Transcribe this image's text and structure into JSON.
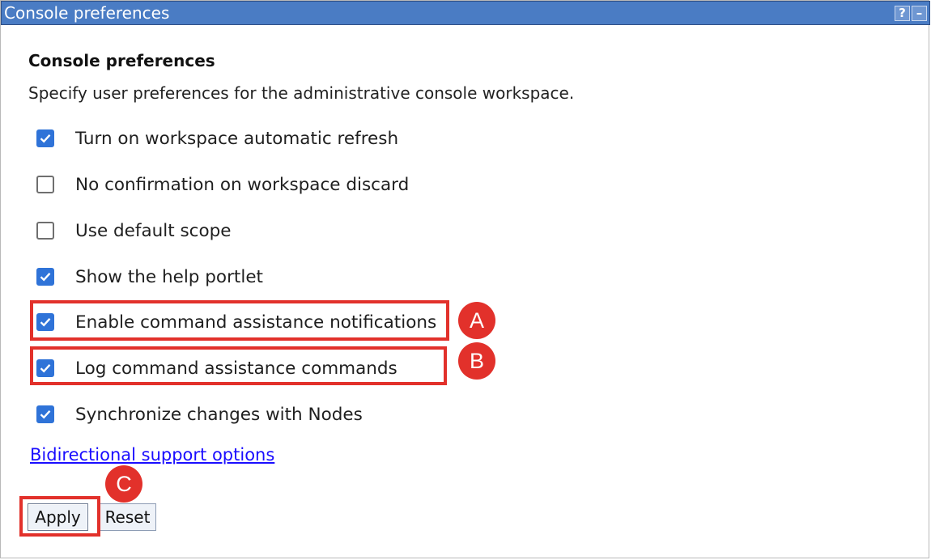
{
  "window": {
    "title": "Console preferences",
    "help_icon": "?",
    "minimize_icon": "–"
  },
  "page": {
    "heading": "Console preferences",
    "description": "Specify user preferences for the administrative console workspace."
  },
  "options": [
    {
      "label": "Turn on workspace automatic refresh",
      "checked": true
    },
    {
      "label": "No confirmation on workspace discard",
      "checked": false
    },
    {
      "label": "Use default scope",
      "checked": false
    },
    {
      "label": "Show the help portlet",
      "checked": true
    },
    {
      "label": "Enable command assistance notifications",
      "checked": true
    },
    {
      "label": "Log command assistance commands",
      "checked": true
    },
    {
      "label": "Synchronize changes with Nodes",
      "checked": true
    }
  ],
  "link": {
    "label": "Bidirectional support options"
  },
  "buttons": {
    "apply": "Apply",
    "reset": "Reset"
  },
  "annotations": {
    "a": "A",
    "b": "B",
    "c": "C",
    "highlight_color": "#e2312b"
  },
  "colors": {
    "titlebar": "#4a7cc4",
    "checkbox_checked": "#2f73d8",
    "link": "#1a0dff"
  }
}
